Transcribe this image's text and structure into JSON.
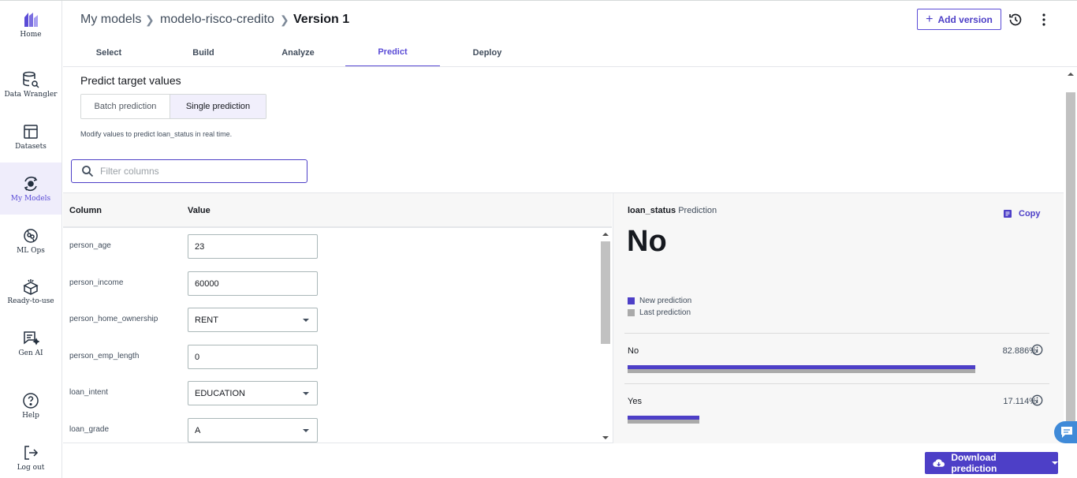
{
  "nav": {
    "items": [
      {
        "label": "Home",
        "icon": "home-logo-icon"
      },
      {
        "label": "Data Wrangler",
        "icon": "data-wrangler-icon"
      },
      {
        "label": "Datasets",
        "icon": "datasets-icon"
      },
      {
        "label": "My Models",
        "icon": "my-models-icon"
      },
      {
        "label": "ML Ops",
        "icon": "ml-ops-icon"
      },
      {
        "label": "Ready-to-use",
        "icon": "ready-to-use-icon"
      },
      {
        "label": "Gen AI",
        "icon": "gen-ai-icon"
      },
      {
        "label": "Help",
        "icon": "help-icon"
      },
      {
        "label": "Log out",
        "icon": "log-out-icon"
      }
    ],
    "active": "My Models"
  },
  "breadcrumb": {
    "items": [
      "My models",
      "modelo-risco-credito",
      "Version 1"
    ]
  },
  "header": {
    "add_version_label": "Add version"
  },
  "tabs": [
    "Select",
    "Build",
    "Analyze",
    "Predict",
    "Deploy"
  ],
  "active_tab": "Predict",
  "main": {
    "title": "Predict target values",
    "mode_options": [
      "Batch prediction",
      "Single prediction"
    ],
    "selected_mode": "Single prediction",
    "description": "Modify values to predict loan_status in real time.",
    "filter_placeholder": "Filter columns"
  },
  "table": {
    "headers": {
      "column": "Column",
      "value": "Value"
    },
    "rows": [
      {
        "column": "person_age",
        "value": "23",
        "type": "input"
      },
      {
        "column": "person_income",
        "value": "60000",
        "type": "input"
      },
      {
        "column": "person_home_ownership",
        "value": "RENT",
        "type": "select"
      },
      {
        "column": "person_emp_length",
        "value": "0",
        "type": "input"
      },
      {
        "column": "loan_intent",
        "value": "EDUCATION",
        "type": "select"
      },
      {
        "column": "loan_grade",
        "value": "A",
        "type": "select"
      }
    ]
  },
  "prediction": {
    "target": "loan_status",
    "suffix": "Prediction",
    "value": "No",
    "copy_label": "Copy",
    "legend": {
      "new": "New prediction",
      "last": "Last prediction"
    },
    "colors": {
      "new": "#4d3fc7",
      "last": "#aaaaaa",
      "accent": "#5a4bd6"
    },
    "classes": [
      {
        "label": "No",
        "pct_text": "82.886%",
        "new": 0.82886,
        "last": 0.82886
      },
      {
        "label": "Yes",
        "pct_text": "17.114%",
        "new": 0.17114,
        "last": 0.17114
      }
    ]
  },
  "footer": {
    "download_label": "Download prediction"
  }
}
